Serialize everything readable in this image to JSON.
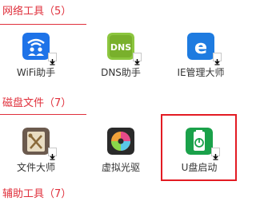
{
  "sections": [
    {
      "title": "网络工具（5）",
      "tools": [
        {
          "label": "WiFi助手",
          "icon": "wifi-assistant-icon",
          "color": "#1e73e8"
        },
        {
          "label": "DNS助手",
          "icon": "dns-assistant-icon",
          "color": "#8cc63f"
        },
        {
          "label": "IE管理大师",
          "icon": "ie-manager-icon",
          "color": "#1e7be0"
        }
      ]
    },
    {
      "title": "磁盘文件（7）",
      "tools": [
        {
          "label": "文件大师",
          "icon": "file-master-icon",
          "color": "#6b5a4e"
        },
        {
          "label": "虚拟光驱",
          "icon": "virtual-drive-icon",
          "color": "#2a2a2a"
        },
        {
          "label": "U盘启动",
          "icon": "usb-boot-icon",
          "color": "#1aa14a"
        }
      ]
    },
    {
      "title": "辅助工具（7）",
      "tools": []
    }
  ],
  "highlight_color": "#e31b23",
  "accent_color": "#e0303c"
}
